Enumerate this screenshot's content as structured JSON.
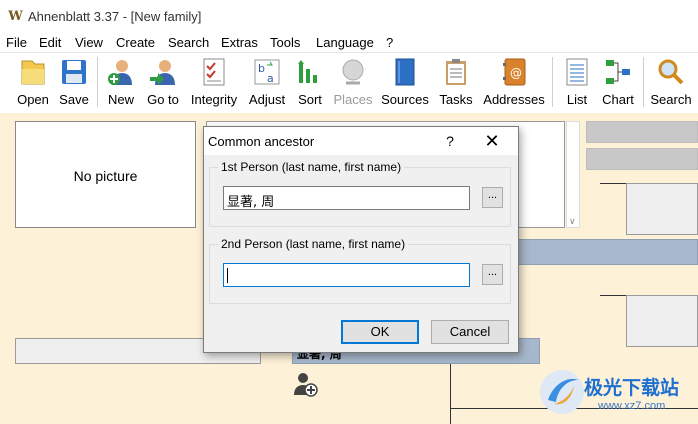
{
  "window": {
    "title": "Ahnenblatt 3.37 - [New family]",
    "icon": "ahnenblatt-logo-icon",
    "icon_glyph": "W"
  },
  "menu": [
    "File",
    "Edit",
    "View",
    "Create",
    "Search",
    "Extras",
    "Tools",
    "Language",
    "?"
  ],
  "toolbar": {
    "buttons": [
      {
        "label": "Open",
        "icon": "folder-open-icon"
      },
      {
        "label": "Save",
        "icon": "floppy-disk-icon"
      },
      {
        "label": "New",
        "icon": "add-person-icon"
      },
      {
        "label": "Go to",
        "icon": "go-to-person-icon"
      },
      {
        "label": "Integrity",
        "icon": "checklist-icon"
      },
      {
        "label": "Adjust",
        "icon": "adjust-icon"
      },
      {
        "label": "Sort",
        "icon": "sort-icon"
      },
      {
        "label": "Places",
        "icon": "globe-icon",
        "disabled": true
      },
      {
        "label": "Sources",
        "icon": "book-icon"
      },
      {
        "label": "Tasks",
        "icon": "clipboard-icon"
      },
      {
        "label": "Addresses",
        "icon": "address-book-icon"
      },
      {
        "label": "List",
        "icon": "list-icon"
      },
      {
        "label": "Chart",
        "icon": "tree-chart-icon"
      },
      {
        "label": "Search",
        "icon": "magnifier-icon"
      }
    ]
  },
  "workspace": {
    "no_picture": "No picture",
    "person_name_fragment": "显著, 周",
    "add_person_icon": "add-person-icon"
  },
  "dialog": {
    "title": "Common ancestor",
    "help": "?",
    "close": "✕",
    "first_person": {
      "label": "1st Person (last name, first name)",
      "value": "显著, 周",
      "browse": "..."
    },
    "second_person": {
      "label": "2nd Person (last name, first name)",
      "value": "",
      "browse": "..."
    },
    "ok": "OK",
    "cancel": "Cancel"
  },
  "watermark": {
    "text": "极光下载站",
    "url": "www.xz7.com"
  },
  "colors": {
    "workspace_bg": "#fdf1d8",
    "accent": "#0078d7",
    "highlight_box": "#a8b8cc"
  }
}
